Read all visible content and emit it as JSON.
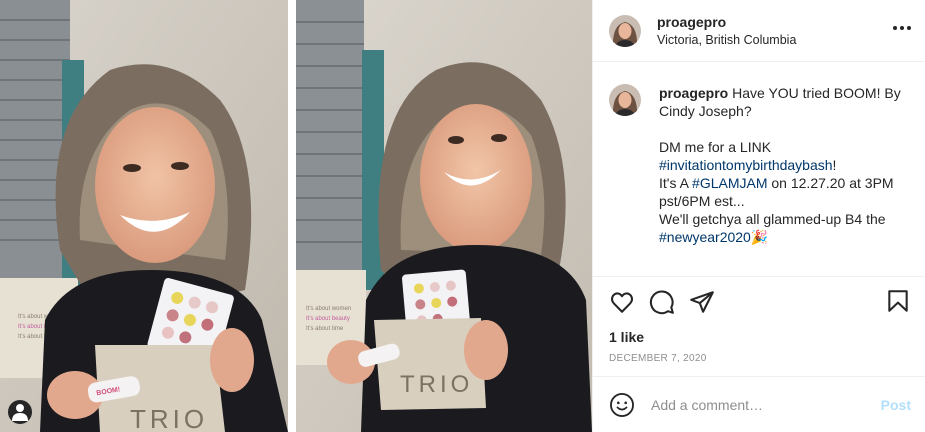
{
  "header": {
    "username": "proagepro",
    "location": "Victoria, British Columbia"
  },
  "caption": {
    "username": "proagepro",
    "line1": " Have YOU tried BOOM! By Cindy Joseph?",
    "line2": "DM me for a LINK",
    "tag_birthday": "#invitationtomybirthdaybash",
    "excl": "!",
    "line3_pre": "It's A ",
    "tag_glamjam": "#GLAMJAM",
    "line3_post": " on 12.27.20 at 3PM pst/6PM est...",
    "line4": "We'll getchya all glammed-up B4 the ",
    "tag_newyear": "#newyear2020",
    "party_emoji": "🎉"
  },
  "actions": {
    "likes": "1 like",
    "date": "DECEMBER 7, 2020"
  },
  "comment": {
    "placeholder": "Add a comment…",
    "post_label": "Post"
  },
  "photos": {
    "pouch_text": "TRIO",
    "tube_text": "BOOM!",
    "pillow_lines": [
      "It's about women",
      "It's about beauty",
      "It's about time"
    ]
  },
  "colors": {
    "link": "#00376b",
    "post_disabled": "#b2dffc",
    "meta_grey": "#8e8e8e"
  }
}
